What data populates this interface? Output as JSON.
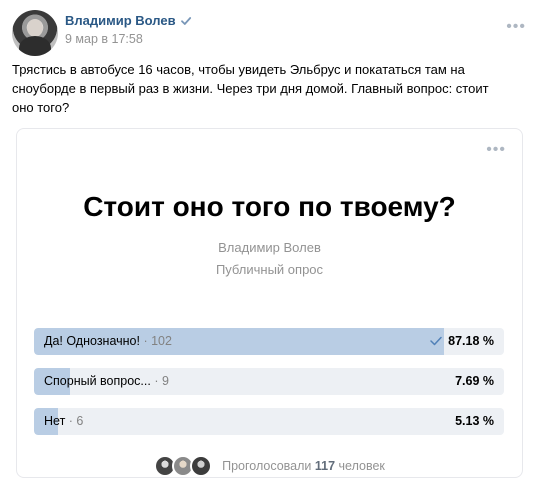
{
  "post": {
    "author": "Владимир Волев",
    "date": "9 мар в 17:58",
    "text": "Трястись в автобусе 16 часов, чтобы увидеть Эльбрус и покататься там на сноуборде в первый раз в жизни. Через три дня домой. Главный вопрос: стоит оно того?",
    "more_icon": "ellipsis-icon"
  },
  "poll": {
    "question": "Стоит оно того по твоему?",
    "author": "Владимир Волев",
    "type": "Публичный опрос",
    "answers": [
      {
        "text": "Да! Однозначно!",
        "count": "· 102",
        "percent": "87.18 %",
        "fraction": 0.8718,
        "selected": true
      },
      {
        "text": "Спорный вопрос...",
        "count": "· 9",
        "percent": "7.69 %",
        "fraction": 0.0769,
        "selected": false
      },
      {
        "text": "Нет",
        "count": "· 6",
        "percent": "5.13 %",
        "fraction": 0.0513,
        "selected": false
      }
    ],
    "voters_prefix": "Проголосовали",
    "voters_count": "117",
    "voters_suffix": "человек"
  },
  "colors": {
    "accent": "#2a5885",
    "bar_fill": "#b9cde4",
    "bar_bg": "#edf0f4",
    "muted": "#939393"
  }
}
